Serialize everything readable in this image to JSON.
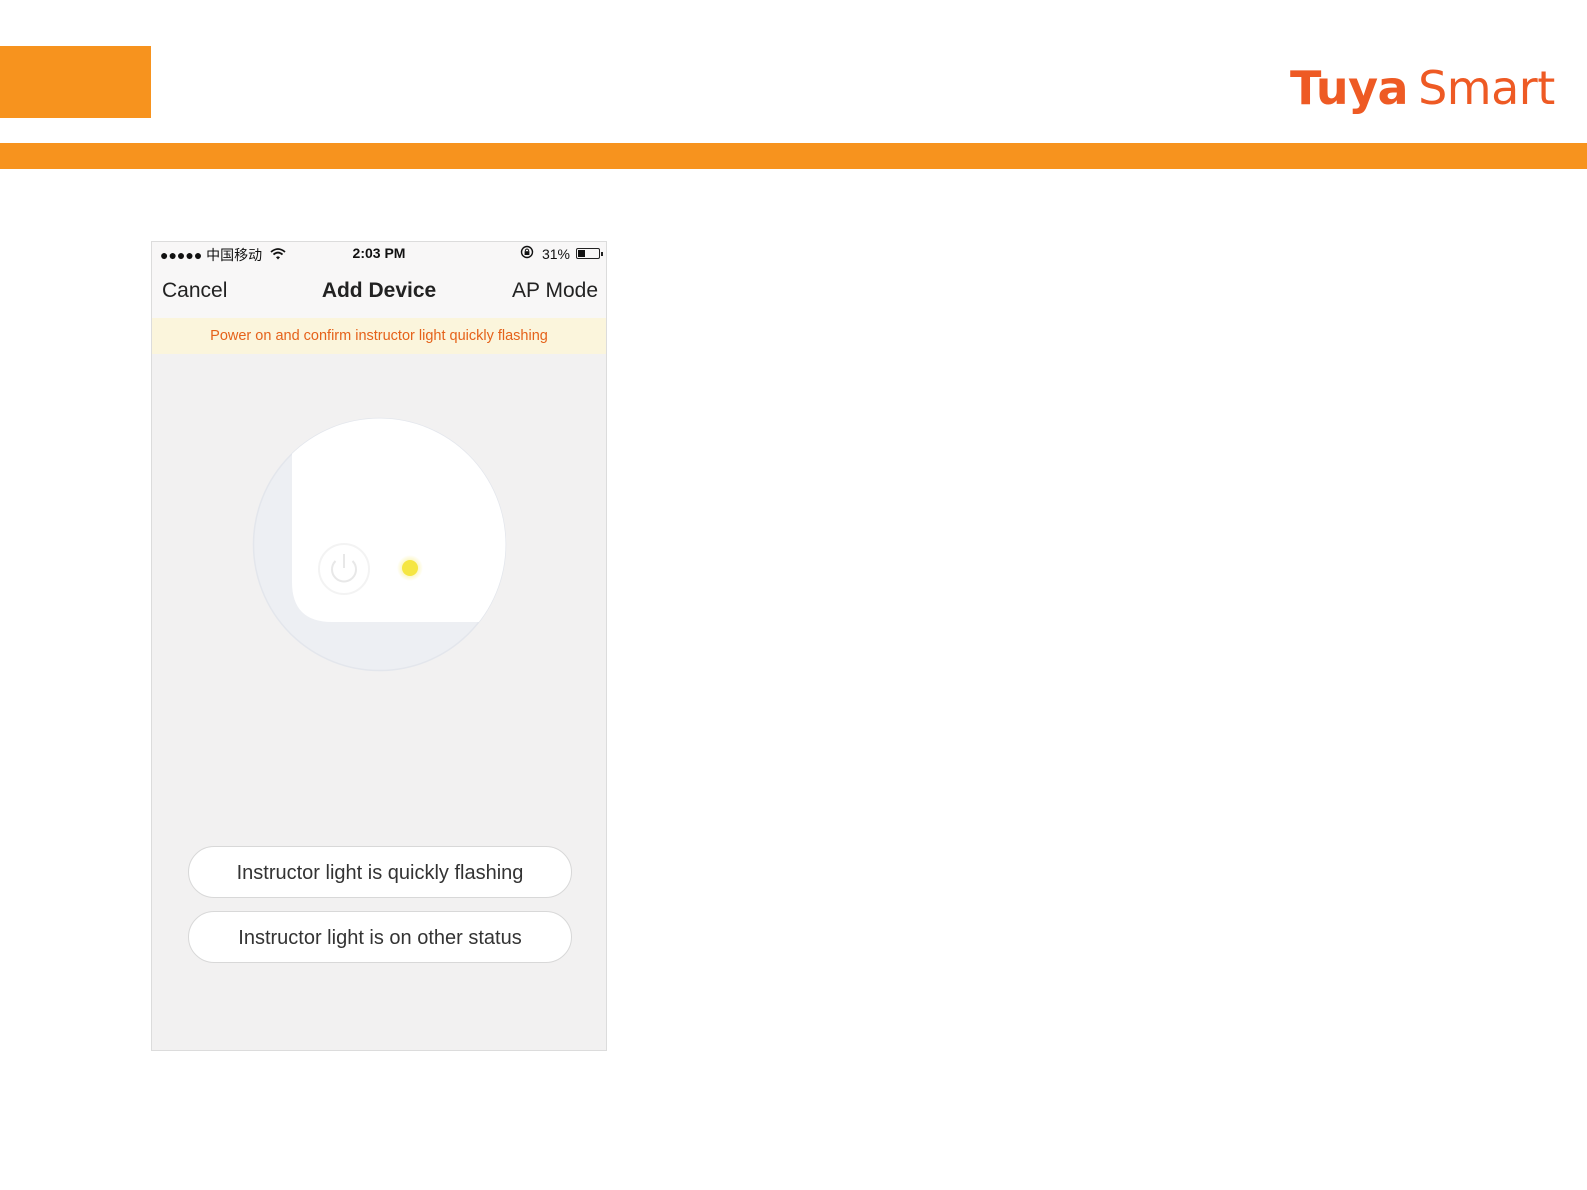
{
  "brand": {
    "name_bold": "Tuya",
    "name_light": "Smart",
    "color": "#EE5A24"
  },
  "accent_color": "#F7931E",
  "phone": {
    "status_bar": {
      "carrier": "●●●●● 中国移动",
      "time": "2:03 PM",
      "battery_percent": "31%",
      "battery_level": 0.31,
      "icons": [
        "wifi-icon",
        "rotation-lock-icon",
        "battery-icon"
      ]
    },
    "nav": {
      "cancel_label": "Cancel",
      "title": "Add Device",
      "mode_label": "AP Mode"
    },
    "banner": {
      "text": "Power on and confirm instructor light quickly flashing",
      "color": "#E5621A"
    },
    "illustration": {
      "icons": [
        "power-button-icon",
        "indicator-light-icon"
      ],
      "indicator_color": "#F5E642"
    },
    "buttons": {
      "flashing_label": "Instructor light is quickly flashing",
      "other_status_label": "Instructor light is on other status"
    }
  }
}
